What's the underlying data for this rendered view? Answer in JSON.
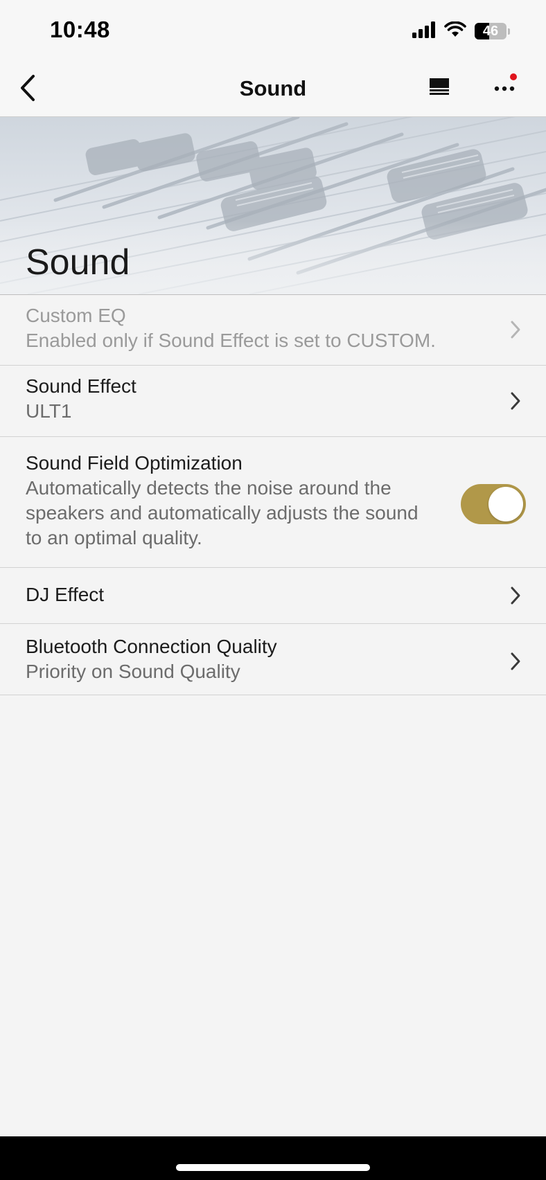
{
  "status_bar": {
    "time": "10:48",
    "battery_level": "46",
    "icons": [
      "signal-icon",
      "wifi-icon",
      "battery-icon"
    ]
  },
  "nav": {
    "title": "Sound",
    "icons": [
      "back-chevron-icon",
      "menu-icon",
      "more-icon"
    ],
    "notification_dot_color": "#e0141d"
  },
  "hero": {
    "title": "Sound",
    "image": "mixing-console-faders"
  },
  "rows": [
    {
      "title": "Custom EQ",
      "subtitle": "Enabled only if Sound Effect is set to CUSTOM.",
      "enabled": false
    },
    {
      "title": "Sound Effect",
      "subtitle": "ULT1",
      "enabled": true
    },
    {
      "title": "Sound Field Optimization",
      "subtitle_lines": [
        "Automatically detects the noise around the",
        "speakers and automatically adjusts the sound",
        "to an optimal quality."
      ],
      "toggle_on": true
    },
    {
      "title": "DJ Effect",
      "enabled": true
    },
    {
      "title": "Bluetooth Connection Quality",
      "subtitle": "Priority on Sound Quality",
      "enabled": true
    }
  ],
  "colors": {
    "toggle_on": "#b19849",
    "background": "#f4f4f4"
  }
}
